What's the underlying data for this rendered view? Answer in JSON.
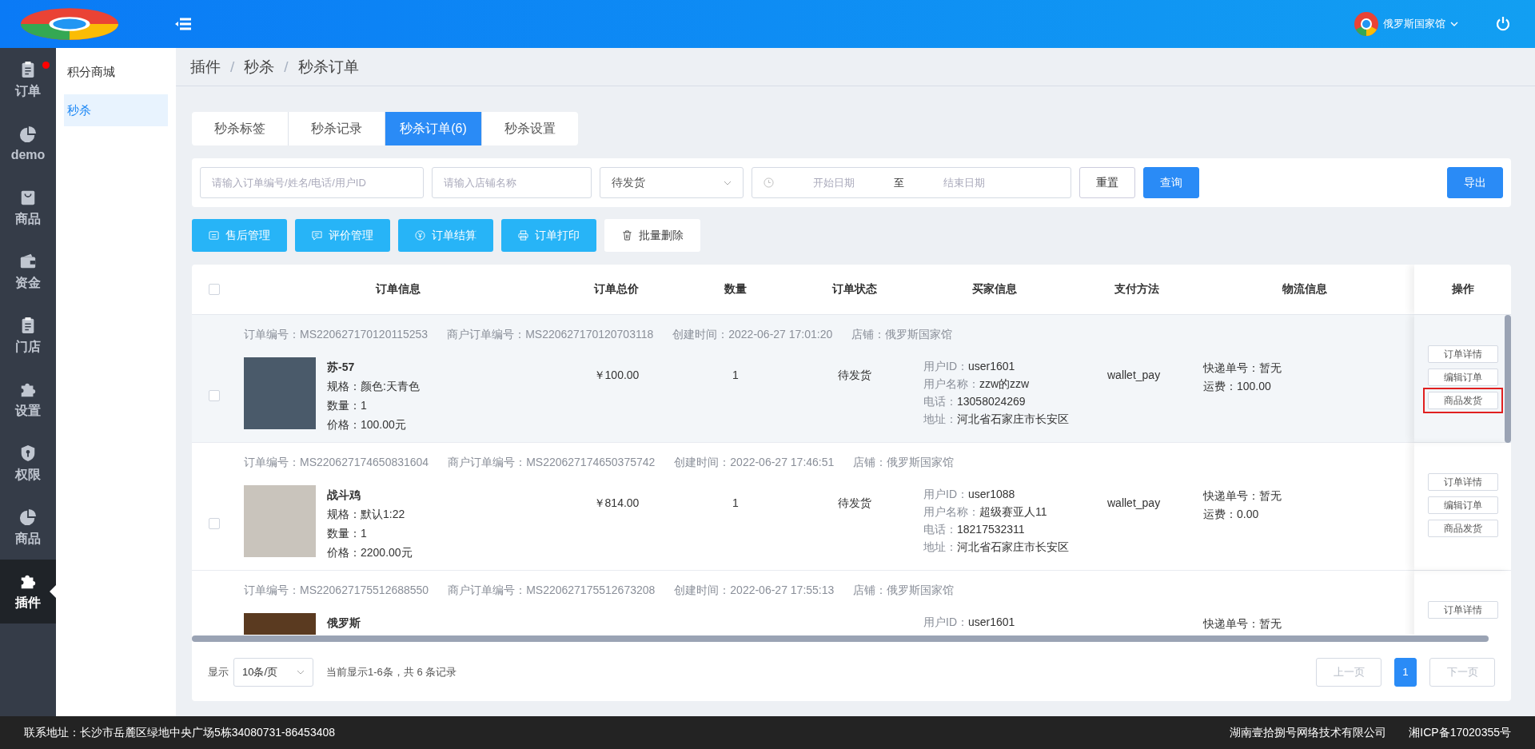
{
  "header": {
    "user_name": "俄罗斯国家馆"
  },
  "sidebar": {
    "items": [
      {
        "label": "订单",
        "selected": false,
        "dot": true
      },
      {
        "label": "demo",
        "selected": false,
        "dot": false
      },
      {
        "label": "商品",
        "selected": false,
        "dot": false
      },
      {
        "label": "资金",
        "selected": false,
        "dot": false
      },
      {
        "label": "门店",
        "selected": false,
        "dot": false
      },
      {
        "label": "设置",
        "selected": false,
        "dot": false
      },
      {
        "label": "权限",
        "selected": false,
        "dot": false
      },
      {
        "label": "商品",
        "selected": false,
        "dot": false
      },
      {
        "label": "插件",
        "selected": true,
        "dot": false
      }
    ]
  },
  "submenu": {
    "items": [
      {
        "label": "积分商城",
        "selected": false
      },
      {
        "label": "秒杀",
        "selected": true
      }
    ]
  },
  "breadcrumb": {
    "separator": "/",
    "items": [
      "插件",
      "秒杀",
      "秒杀订单"
    ]
  },
  "tabs": [
    {
      "label": "秒杀标签",
      "selected": false
    },
    {
      "label": "秒杀记录",
      "selected": false
    },
    {
      "label": "秒杀订单(6)",
      "selected": true
    },
    {
      "label": "秒杀设置",
      "selected": false
    }
  ],
  "filters": {
    "order_search": {
      "placeholder": "请输入订单编号/姓名/电话/用户ID"
    },
    "store_search": {
      "placeholder": "请输入店铺名称"
    },
    "status_select": {
      "value": "待发货"
    },
    "date_range": {
      "start_placeholder": "开始日期",
      "separator": "至",
      "end_placeholder": "结束日期"
    },
    "reset_button": "重置",
    "query_button": "查询",
    "export_button": "导出"
  },
  "actions": [
    {
      "label": "售后管理",
      "kind": "primary"
    },
    {
      "label": "评价管理",
      "kind": "primary"
    },
    {
      "label": "订单结算",
      "kind": "primary"
    },
    {
      "label": "订单打印",
      "kind": "primary"
    },
    {
      "label": "批量删除",
      "kind": "plain"
    }
  ],
  "table": {
    "columns": [
      "订单信息",
      "订单总价",
      "数量",
      "订单状态",
      "买家信息",
      "支付方法",
      "物流信息",
      "操作"
    ],
    "header_checked": false,
    "rows": [
      {
        "hovered": true,
        "checked": false,
        "meta": [
          "订单编号：MS220627170120115253",
          "商户订单编号：MS220627170120703118",
          "创建时间：2022-06-27 17:01:20",
          "店铺：俄罗斯国家馆"
        ],
        "product": {
          "name": "苏-57",
          "lines": [
            "规格：颜色:天青色",
            "数量：1",
            "价格：100.00元"
          ]
        },
        "price": "￥100.00",
        "quantity": "1",
        "status": "待发货",
        "buyer": [
          {
            "label": "用户ID：",
            "value": "user1601"
          },
          {
            "label": "用户名称：",
            "value": "zzw的zzw"
          },
          {
            "label": "电话：",
            "value": "13058024269"
          },
          {
            "label": "地址：",
            "value": "河北省石家庄市长安区"
          }
        ],
        "payment": "wallet_pay",
        "logistics": [
          "快递单号：暂无",
          "运费：100.00"
        ],
        "ops": [
          {
            "label": "订单详情",
            "highlighted": false
          },
          {
            "label": "编辑订单",
            "highlighted": false
          },
          {
            "label": "商品发货",
            "highlighted": true
          }
        ]
      },
      {
        "hovered": false,
        "checked": false,
        "meta": [
          "订单编号：MS220627174650831604",
          "商户订单编号：MS220627174650375742",
          "创建时间：2022-06-27 17:46:51",
          "店铺：俄罗斯国家馆"
        ],
        "product": {
          "name": "战斗鸡",
          "lines": [
            "规格：默认1:22",
            "数量：1",
            "价格：2200.00元"
          ]
        },
        "price": "￥814.00",
        "quantity": "1",
        "status": "待发货",
        "buyer": [
          {
            "label": "用户ID：",
            "value": "user1088"
          },
          {
            "label": "用户名称：",
            "value": "超级赛亚人11"
          },
          {
            "label": "电话：",
            "value": "18217532311"
          },
          {
            "label": "地址：",
            "value": "河北省石家庄市长安区"
          }
        ],
        "payment": "wallet_pay",
        "logistics": [
          "快递单号：暂无",
          "运费：0.00"
        ],
        "ops": [
          {
            "label": "订单详情",
            "highlighted": false
          },
          {
            "label": "编辑订单",
            "highlighted": false
          },
          {
            "label": "商品发货",
            "highlighted": false
          }
        ]
      },
      {
        "hovered": false,
        "meta": [
          "订单编号：MS220627175512688550",
          "商户订单编号：MS220627175512673208",
          "创建时间：2022-06-27 17:55:13",
          "店铺：俄罗斯国家馆"
        ],
        "product": {
          "name": "俄罗斯"
        },
        "buyer": [
          {
            "label": "用户ID：",
            "value": "user1601"
          }
        ],
        "logistics": [
          "快递单号：暂无"
        ],
        "ops": [
          {
            "label": "订单详情",
            "highlighted": false
          }
        ]
      }
    ]
  },
  "pagination": {
    "show_label": "显示",
    "page_size": "10条/页",
    "summary": "当前显示1-6条，共 6 条记录",
    "prev": {
      "label": "上一页",
      "disabled": true
    },
    "pages": [
      {
        "label": "1",
        "selected": true
      }
    ],
    "next": {
      "label": "下一页",
      "disabled": true
    }
  },
  "footer": {
    "address": "联系地址：长沙市岳麓区绿地中央广场5栋34080731-86453408",
    "company": "湖南壹拾捌号网络技术有限公司",
    "icp": "湘ICP备17020355号"
  }
}
